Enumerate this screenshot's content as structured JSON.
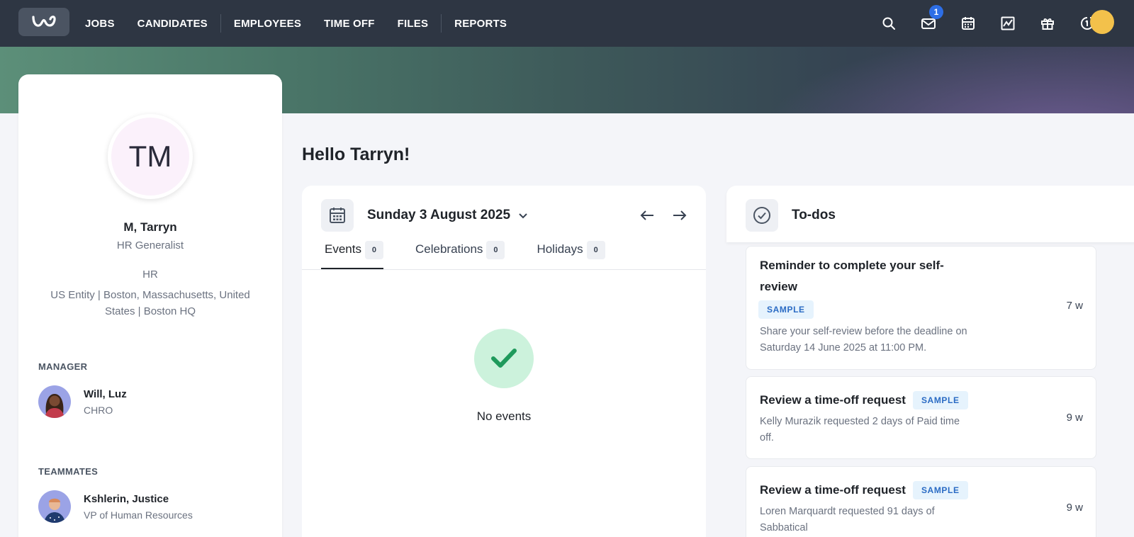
{
  "nav": {
    "links": [
      "JOBS",
      "CANDIDATES",
      "EMPLOYEES",
      "TIME OFF",
      "FILES",
      "REPORTS"
    ],
    "icons": [
      "search-icon",
      "mail-icon",
      "calendar-icon",
      "chart-icon",
      "gift-icon",
      "updates-icon"
    ],
    "mail_badge": "1"
  },
  "profile": {
    "initials": "TM",
    "name": "M, Tarryn",
    "title": "HR Generalist",
    "department": "HR",
    "location": "US Entity | Boston, Massachusetts, United States | Boston HQ",
    "manager_label": "MANAGER",
    "manager": {
      "name": "Will, Luz",
      "role": "CHRO"
    },
    "teammates_label": "TEAMMATES",
    "teammates": [
      {
        "name": "Kshlerin, Justice",
        "role": "VP of Human Resources"
      }
    ]
  },
  "greeting": "Hello Tarryn!",
  "events": {
    "date": "Sunday 3 August 2025",
    "tabs": [
      {
        "label": "Events",
        "count": "0"
      },
      {
        "label": "Celebrations",
        "count": "0"
      },
      {
        "label": "Holidays",
        "count": "0"
      }
    ],
    "empty_text": "No events"
  },
  "todos": {
    "title": "To-dos",
    "items": [
      {
        "title_line1": "Reminder to complete your self-",
        "title_line2": "review",
        "badge": "SAMPLE",
        "description": "Share your self-review before the deadline on Saturday 14 June 2025 at 11:00 PM.",
        "age": "7 w"
      },
      {
        "title": "Review a time-off request",
        "badge": "SAMPLE",
        "description": "Kelly Murazik requested 2 days of Paid time off.",
        "age": "9 w"
      },
      {
        "title": "Review a time-off request",
        "badge": "SAMPLE",
        "description": "Loren Marquardt requested 91 days of Sabbatical",
        "age": "9 w"
      }
    ]
  },
  "colors": {
    "nav_bg": "#2e3643",
    "badge": "#2d6ee6",
    "sample_text": "#2a6bc4",
    "check_bg": "#ccf2dc",
    "check": "#1f9a5c"
  }
}
